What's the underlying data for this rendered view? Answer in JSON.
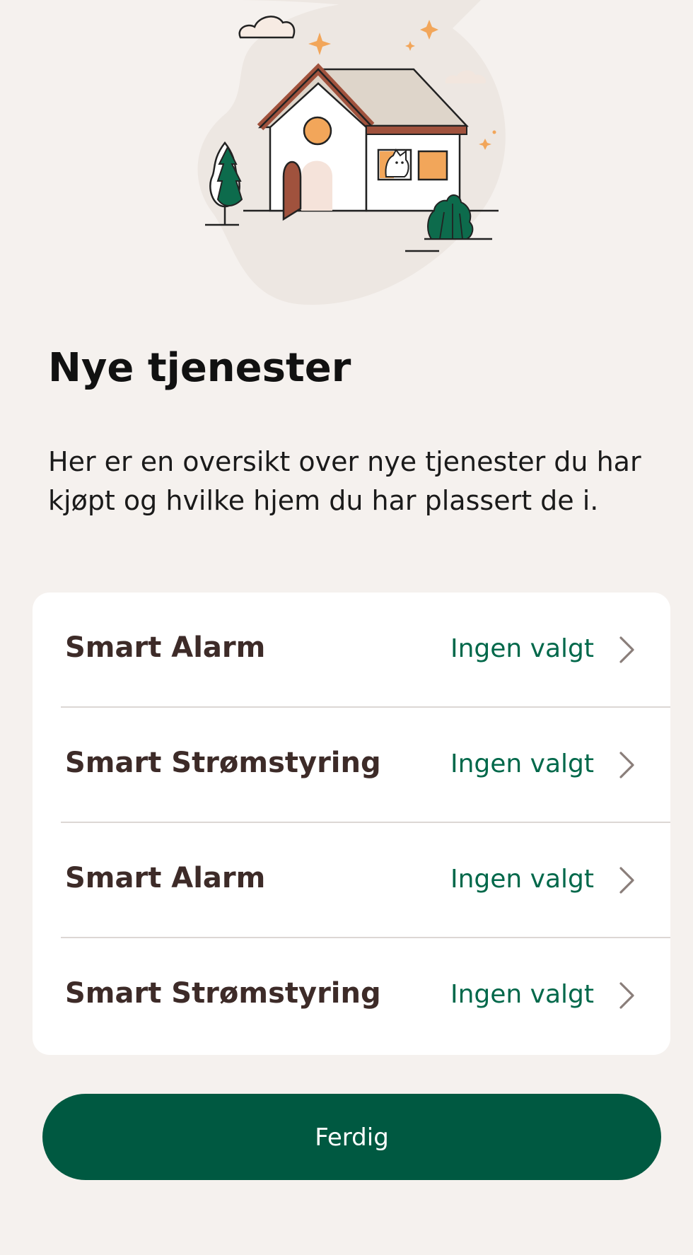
{
  "header": {
    "title": "Nye tjenester",
    "description": "Her er en oversikt over nye tjenester du har kjøpt og hvilke hjem du har plassert de i."
  },
  "services": [
    {
      "name": "Smart Alarm",
      "home": "Ingen valgt"
    },
    {
      "name": "Smart Strømstyring",
      "home": "Ingen valgt"
    },
    {
      "name": "Smart Alarm",
      "home": "Ingen valgt"
    },
    {
      "name": "Smart Strømstyring",
      "home": "Ingen valgt"
    }
  ],
  "footer": {
    "done_label": "Ferdig"
  },
  "colors": {
    "background": "#f5f1ee",
    "accent_green": "#005941",
    "value_green": "#00684a",
    "text_brown": "#3d2b28",
    "illustration_orange": "#f2a65a",
    "illustration_brown": "#a0523d"
  },
  "icons": {
    "row_chevron": "chevron-right-icon",
    "illustration": "house-illustration"
  }
}
